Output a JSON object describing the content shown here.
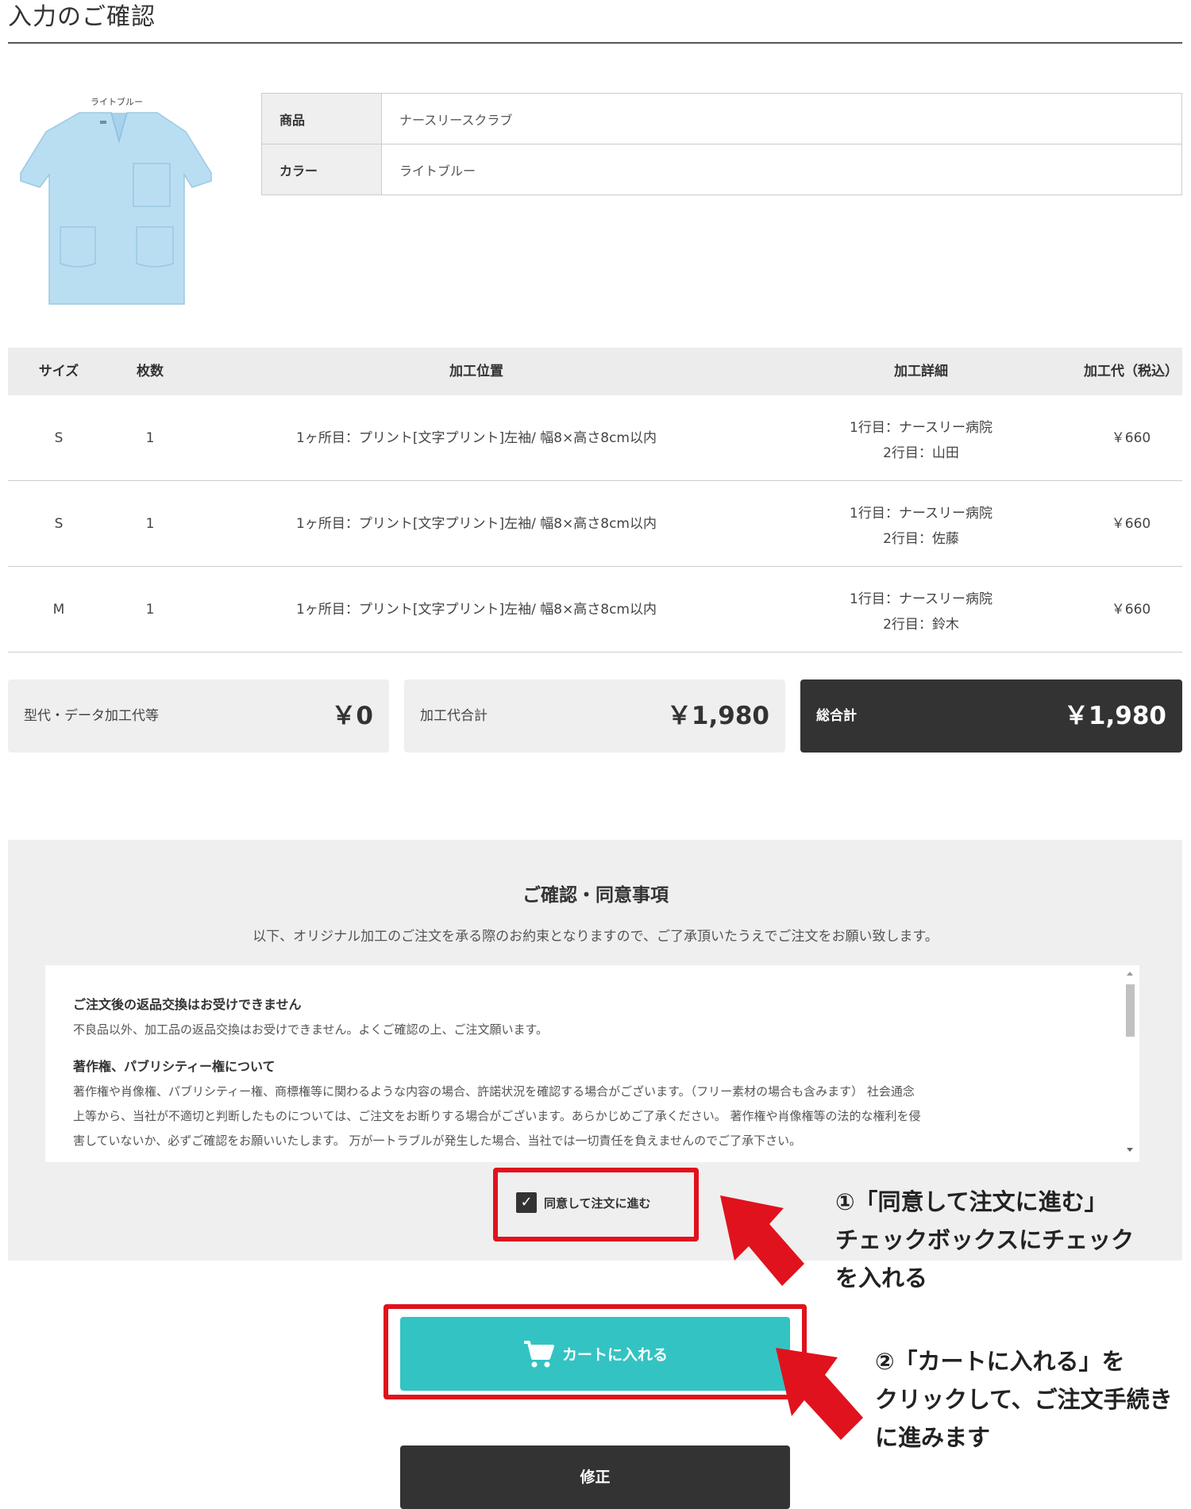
{
  "page": {
    "title": "入力のご確認"
  },
  "product": {
    "image_caption": "ライトブルー",
    "rows": [
      {
        "key": "商品",
        "value": "ナースリースクラブ"
      },
      {
        "key": "カラー",
        "value": "ライトブルー"
      }
    ]
  },
  "processing": {
    "headers": [
      "サイズ",
      "枚数",
      "加工位置",
      "加工詳細",
      "加工代（税込）"
    ],
    "rows": [
      {
        "size": "S",
        "qty": "1",
        "position": "1ヶ所目：プリント[文字プリント]左袖/ 幅8×高さ8cm以内",
        "detail_1": "1行目：ナースリー病院",
        "detail_2": "2行目：山田",
        "fee": "￥660"
      },
      {
        "size": "S",
        "qty": "1",
        "position": "1ヶ所目：プリント[文字プリント]左袖/ 幅8×高さ8cm以内",
        "detail_1": "1行目：ナースリー病院",
        "detail_2": "2行目：佐藤",
        "fee": "￥660"
      },
      {
        "size": "M",
        "qty": "1",
        "position": "1ヶ所目：プリント[文字プリント]左袖/ 幅8×高さ8cm以内",
        "detail_1": "1行目：ナースリー病院",
        "detail_2": "2行目：鈴木",
        "fee": "￥660"
      }
    ]
  },
  "totals": [
    {
      "label": "型代・データ加工代等",
      "amount": "￥0"
    },
    {
      "label": "加工代合計",
      "amount": "￥1,980"
    },
    {
      "label": "総合計",
      "amount": "￥1,980"
    }
  ],
  "consent": {
    "title": "ご確認・同意事項",
    "subtitle": "以下、オリジナル加工のご注文を承る際のお約束となりますので、ご了承頂いたうえでご注文をお願い致します。",
    "sections": [
      {
        "heading": "ご注文後の返品交換はお受けできません",
        "lines": [
          "不良品以外、加工品の返品交換はお受けできません。よくご確認の上、ご注文願います。"
        ]
      },
      {
        "heading": "著作権、パブリシティー権について",
        "lines": [
          "著作権や肖像権、パブリシティー権、商標権等に関わるような内容の場合、許諾状況を確認する場合がございます。（フリー素材の場合も含みます） 社会通念",
          "上等から、当社が不適切と判断したものについては、ご注文をお断りする場合がございます。あらかじめご了承ください。 著作権や肖像権等の法的な権利を侵",
          "害していないか、必ずご確認をお願いいたします。 万が一トラブルが発生した場合、当社では一切責任を負えませんのでご了承下さい。"
        ]
      }
    ],
    "checkbox_label": "同意して注文に進む",
    "checkbox_checked": true
  },
  "buttons": {
    "cart": "カートに入れる",
    "fix": "修正"
  },
  "annotations": {
    "note1": [
      "①「同意して注文に進む」",
      "チェックボックスにチェック",
      "を入れる"
    ],
    "note2": [
      "②「カートに入れる」を",
      "クリックして、ご注文手続き",
      "に進みます"
    ],
    "color": "#e0121d"
  },
  "colors": {
    "accent": "#33c3c3",
    "dark": "#333333",
    "panel": "#efefef"
  }
}
